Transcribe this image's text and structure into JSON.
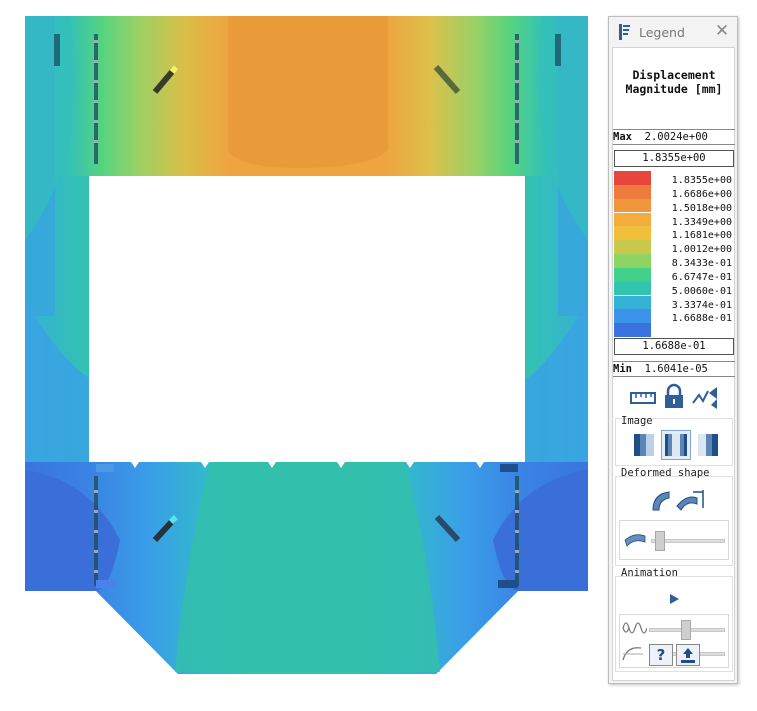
{
  "legend": {
    "title": "Legend",
    "heading_line1": "Displacement",
    "heading_line2": "Magnitude [mm]",
    "max_label": "Max",
    "max_value": "2.0024e+00",
    "upper_limit": "1.8355e+00",
    "scale_labels": [
      "1.8355e+00",
      "1.6686e+00",
      "1.5018e+00",
      "1.3349e+00",
      "1.1681e+00",
      "1.0012e+00",
      "8.3433e-01",
      "6.6747e-01",
      "5.0060e-01",
      "3.3374e-01",
      "1.6688e-01"
    ],
    "scale_colors": [
      "#e8453c",
      "#ee7a3c",
      "#f0963c",
      "#f2ad3c",
      "#f0c03c",
      "#c8c84a",
      "#8ed463",
      "#43d08a",
      "#33c4b0",
      "#36b2d8",
      "#3b94ea",
      "#3a72e0"
    ],
    "lower_limit": "1.6688e-01",
    "min_label": "Min",
    "min_value": "1.6041e-05",
    "sections": {
      "image": "Image",
      "deformed": "Deformed shape",
      "animation": "Animation"
    },
    "tools": [
      "ruler-icon",
      "lock-icon",
      "probe-icon"
    ],
    "help": "?"
  },
  "colors": {
    "max": "#e8453c",
    "min": "#3a72e0",
    "accent": "#1f4f86"
  }
}
